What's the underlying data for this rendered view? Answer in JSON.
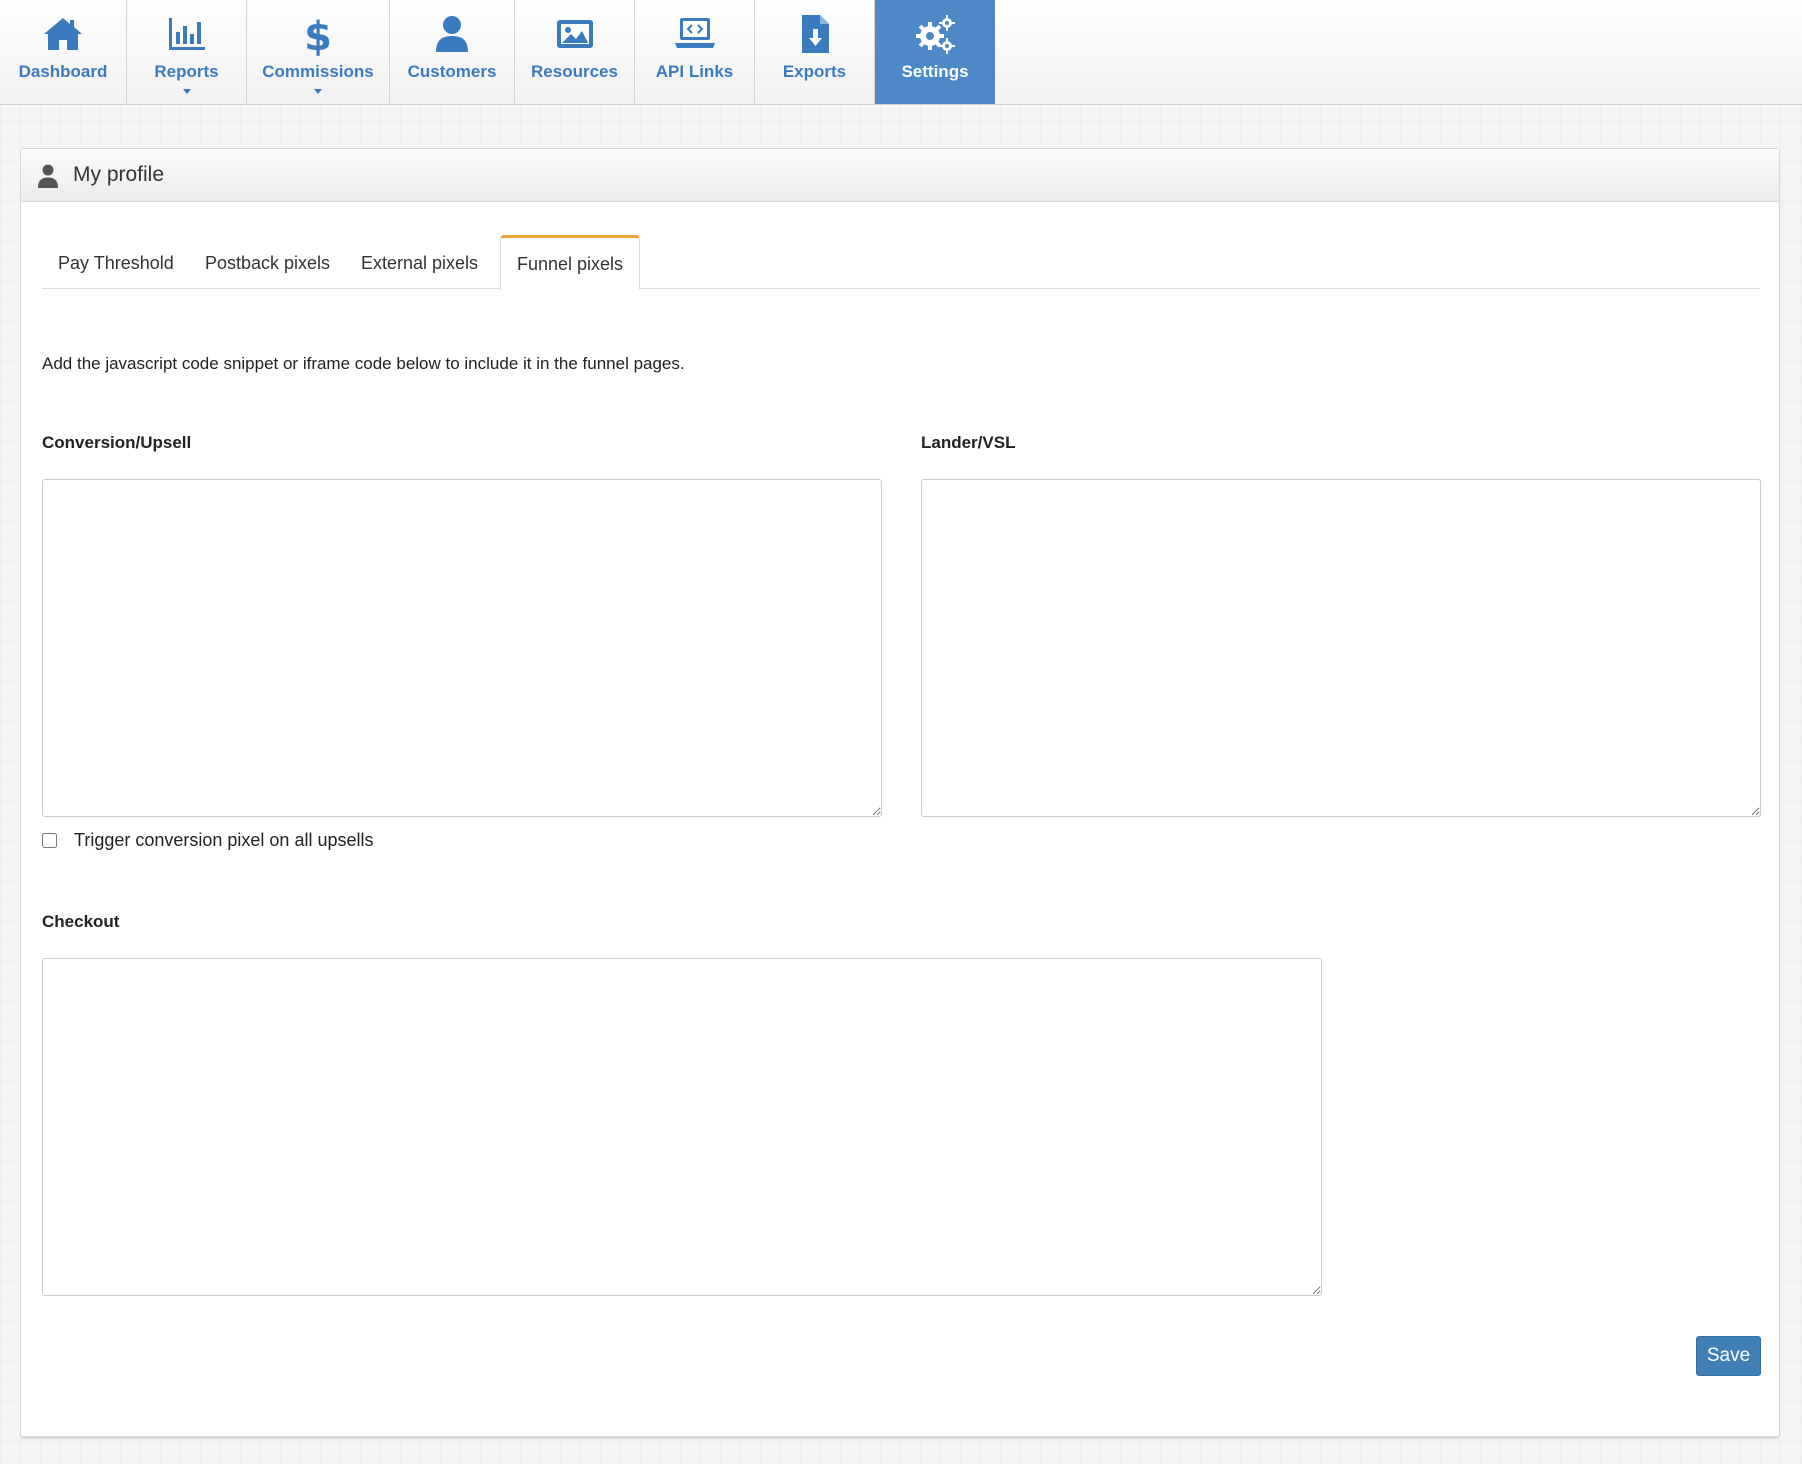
{
  "nav": {
    "items": [
      {
        "label": "Dashboard",
        "icon": "home-icon"
      },
      {
        "label": "Reports",
        "icon": "bar-chart-icon",
        "dropdown": true
      },
      {
        "label": "Commissions",
        "icon": "dollar-icon",
        "dropdown": true
      },
      {
        "label": "Customers",
        "icon": "user-icon"
      },
      {
        "label": "Resources",
        "icon": "image-icon"
      },
      {
        "label": "API Links",
        "icon": "laptop-code-icon"
      },
      {
        "label": "Exports",
        "icon": "file-download-icon"
      },
      {
        "label": "Settings",
        "icon": "gears-icon",
        "active": true
      }
    ],
    "accent_color": "#3a7bc0",
    "active_bg": "#4d88c7"
  },
  "panel": {
    "title": "My profile",
    "icon": "user-icon"
  },
  "tabs": [
    {
      "label": "Pay Threshold"
    },
    {
      "label": "Postback pixels"
    },
    {
      "label": "External pixels"
    },
    {
      "label": "Funnel pixels",
      "active": true
    }
  ],
  "content": {
    "intro": "Add the javascript code snippet or iframe code below to include it in the funnel pages.",
    "conversion_label": "Conversion/Upsell",
    "conversion_value": "",
    "lander_label": "Lander/VSL",
    "lander_value": "",
    "trigger_label": "Trigger conversion pixel on all upsells",
    "trigger_checked": false,
    "checkout_label": "Checkout",
    "checkout_value": "",
    "save_label": "Save"
  },
  "colors": {
    "tab_active_border": "#f0a23a",
    "save_button": "#3f7fb6"
  }
}
